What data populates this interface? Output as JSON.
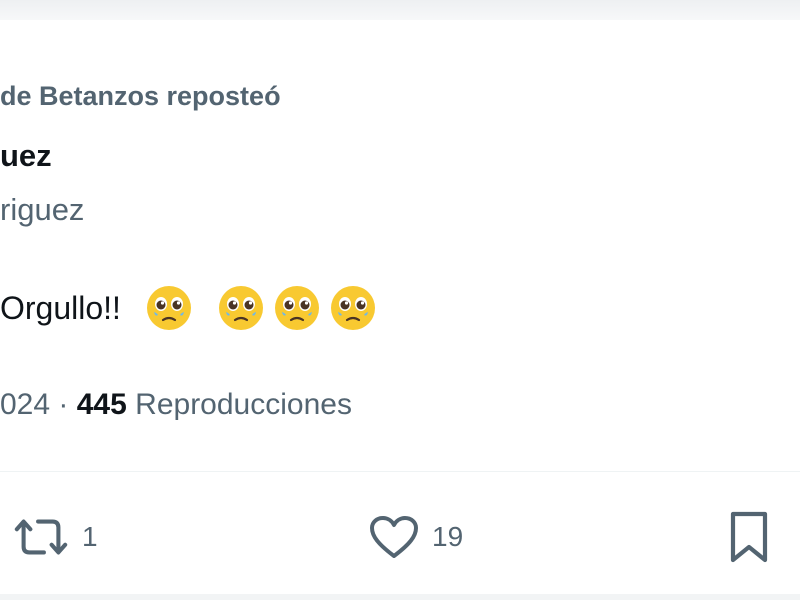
{
  "repost": {
    "text": "de Betanzos reposteó"
  },
  "author": {
    "display_name": "uez",
    "handle": "riguez"
  },
  "tweet": {
    "text": "Orgullo!!",
    "emojis": [
      "pleading-face",
      "pleading-face",
      "pleading-face",
      "pleading-face"
    ]
  },
  "meta": {
    "date_fragment": "024",
    "separator": "·",
    "views_count": "445",
    "views_label": "Reproducciones"
  },
  "actions": {
    "repost_count": "1",
    "like_count": "19"
  },
  "colors": {
    "text_primary": "#0f1419",
    "text_secondary": "#536471",
    "divider": "#eff3f4",
    "emoji_face": "#f8c931",
    "emoji_tear": "#6fb8e8"
  }
}
